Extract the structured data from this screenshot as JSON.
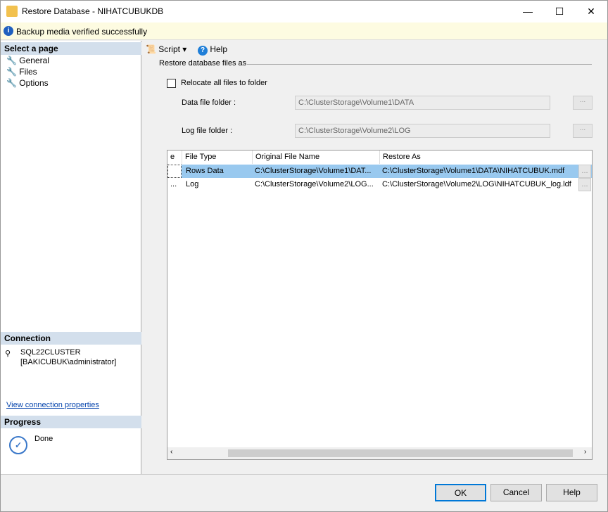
{
  "window": {
    "title": "Restore Database - NIHATCUBUKDB"
  },
  "info": "Backup media verified successfully",
  "left": {
    "select_page": "Select a page",
    "pages": [
      "General",
      "Files",
      "Options"
    ],
    "connection_title": "Connection",
    "server": "SQL22CLUSTER",
    "user": "[BAKICUBUK\\administrator]",
    "view_conn": "View connection properties",
    "progress_title": "Progress",
    "progress_status": "Done"
  },
  "toolbar": {
    "script": "Script",
    "help": "Help"
  },
  "main": {
    "group": "Restore database files as",
    "relocate": "Relocate all files to folder",
    "data_label": "Data file folder :",
    "data_value": "C:\\ClusterStorage\\Volume1\\DATA",
    "log_label": "Log file folder :",
    "log_value": "C:\\ClusterStorage\\Volume2\\LOG",
    "browse": "...",
    "columns": [
      "e",
      "File Type",
      "Original File Name",
      "Restore As"
    ],
    "rows": [
      {
        "c0": "",
        "type": "Rows Data",
        "orig": "C:\\ClusterStorage\\Volume1\\DAT...",
        "restore": "C:\\ClusterStorage\\Volume1\\DATA\\NIHATCUBUK.mdf"
      },
      {
        "c0": "...",
        "type": "Log",
        "orig": "C:\\ClusterStorage\\Volume2\\LOG...",
        "restore": "C:\\ClusterStorage\\Volume2\\LOG\\NIHATCUBUK_log.ldf"
      }
    ]
  },
  "buttons": {
    "ok": "OK",
    "cancel": "Cancel",
    "help": "Help"
  }
}
